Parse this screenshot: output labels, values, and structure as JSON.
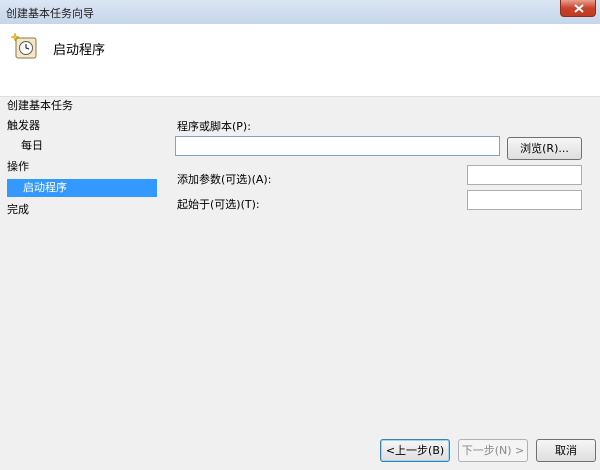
{
  "window": {
    "title": "创建基本任务向导"
  },
  "header": {
    "title": "启动程序"
  },
  "nav": {
    "items": [
      "创建基本任务",
      "触发器",
      "每日",
      "操作",
      "启动程序",
      "完成"
    ]
  },
  "form": {
    "program_label": "程序或脚本(P):",
    "program_value": "",
    "browse_label": "浏览(R)...",
    "args_label": "添加参数(可选)(A):",
    "args_value": "",
    "start_label": "起始于(可选)(T):",
    "start_value": ""
  },
  "footer": {
    "back": "<上一步(B)",
    "next": "下一步(N) >",
    "cancel": "取消"
  }
}
